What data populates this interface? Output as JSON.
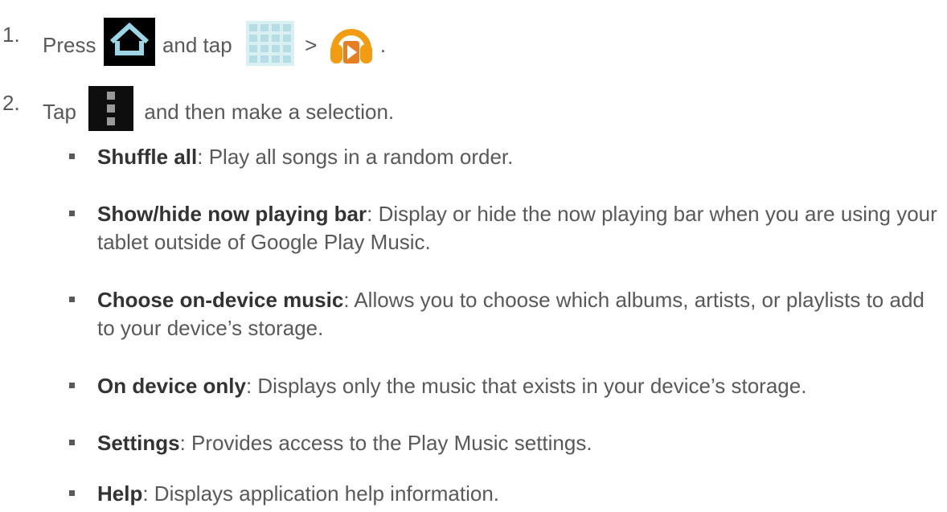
{
  "steps": [
    {
      "number": "1.",
      "text_press": "Press",
      "text_and_tap": "and tap",
      "text_gt": ">",
      "text_end": ".",
      "icons": [
        "home-icon",
        "apps-grid-icon",
        "play-music-headphones-icon"
      ]
    },
    {
      "number": "2.",
      "text_tap": "Tap",
      "text_rest": "and then make a selection.",
      "icons": [
        "overflow-menu-icon"
      ]
    }
  ],
  "options": [
    {
      "term": "Shuffle all",
      "desc": ": Play all songs in a random order."
    },
    {
      "term": "Show/hide now playing bar",
      "desc": ": Display or hide the now playing bar when you are using your tablet outside of Google Play Music."
    },
    {
      "term": "Choose on-device music",
      "desc": ": Allows you to choose which albums, artists, or playlists to add to your device’s storage."
    },
    {
      "term": "On device only",
      "desc": ": Displays only the music that exists in your device’s storage."
    },
    {
      "term": "Settings",
      "desc": ": Provides access to the Play Music settings."
    },
    {
      "term": "Help",
      "desc": ": Displays application help information."
    }
  ],
  "colors": {
    "body_text": "#595959",
    "term_text": "#333333",
    "icon_dark": "#000000",
    "music_orange": "#f39c12"
  }
}
